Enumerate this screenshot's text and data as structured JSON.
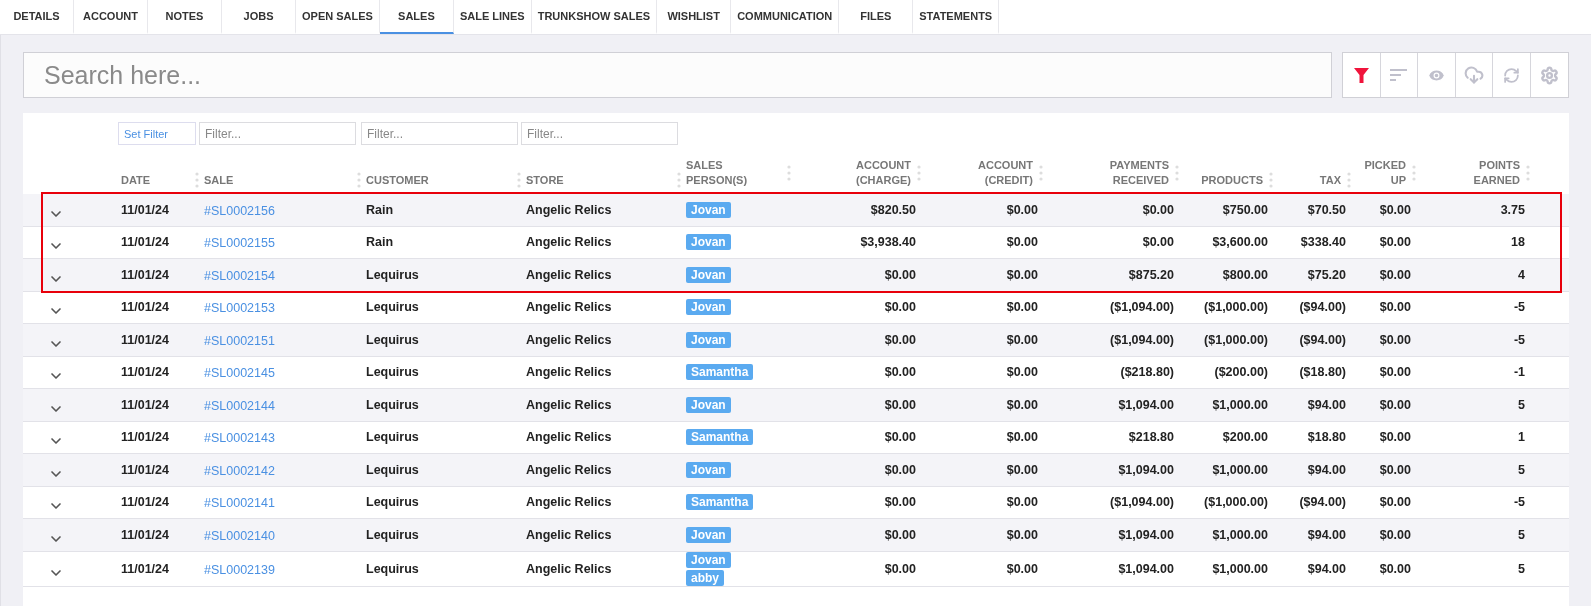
{
  "tabs": [
    {
      "label": "DETAILS",
      "selected": false
    },
    {
      "label": "ACCOUNT",
      "selected": false
    },
    {
      "label": "NOTES",
      "selected": false
    },
    {
      "label": "JOBS",
      "selected": false
    },
    {
      "label": "OPEN SALES",
      "selected": false
    },
    {
      "label": "SALES",
      "selected": true
    },
    {
      "label": "SALE LINES",
      "selected": false
    },
    {
      "label": "TRUNKSHOW SALES",
      "selected": false
    },
    {
      "label": "WISHLIST",
      "selected": false
    },
    {
      "label": "COMMUNICATION",
      "selected": false
    },
    {
      "label": "FILES",
      "selected": false
    },
    {
      "label": "STATEMENTS",
      "selected": false
    }
  ],
  "search": {
    "placeholder": "Search here..."
  },
  "toolbar": [
    {
      "kind": "filter",
      "active": true
    },
    {
      "kind": "sort",
      "active": false
    },
    {
      "kind": "view",
      "active": false
    },
    {
      "kind": "download",
      "active": false
    },
    {
      "kind": "refresh",
      "active": false
    },
    {
      "kind": "settings",
      "active": false
    }
  ],
  "filters": {
    "set_filter": "Set Filter",
    "fields": [
      {
        "placeholder": "Filter..."
      },
      {
        "placeholder": "Filter..."
      },
      {
        "placeholder": "Filter..."
      }
    ]
  },
  "table": {
    "columns": [
      "DATE",
      "SALE",
      "CUSTOMER",
      "STORE",
      "SALES PERSON(S)",
      "ACCOUNT (CHARGE)",
      "ACCOUNT (CREDIT)",
      "PAYMENTS RECEIVED",
      "PRODUCTS",
      "TAX",
      "PICKED UP",
      "POINTS EARNED"
    ],
    "highlighted_rows": [
      {
        "date": "11/01/24",
        "sale": "#SL0002156",
        "customer": "Rain",
        "store": "Angelic Relics",
        "sales_persons": [
          "Jovan"
        ],
        "values": [
          "$820.50",
          "$0.00",
          "$0.00",
          "$750.00",
          "$70.50",
          "$0.00",
          "3.75"
        ]
      },
      {
        "date": "11/01/24",
        "sale": "#SL0002155",
        "customer": "Rain",
        "store": "Angelic Relics",
        "sales_persons": [
          "Jovan"
        ],
        "values": [
          "$3,938.40",
          "$0.00",
          "$0.00",
          "$3,600.00",
          "$338.40",
          "$0.00",
          "18"
        ]
      },
      {
        "date": "11/01/24",
        "sale": "#SL0002154",
        "customer": "Lequirus",
        "store": "Angelic Relics",
        "sales_persons": [
          "Jovan"
        ],
        "values": [
          "$0.00",
          "$0.00",
          "$875.20",
          "$800.00",
          "$75.20",
          "$0.00",
          "4"
        ]
      }
    ],
    "rows": [
      {
        "date": "11/01/24",
        "sale": "#SL0002153",
        "customer": "Lequirus",
        "store": "Angelic Relics",
        "sales_persons": [
          "Jovan"
        ],
        "values": [
          "$0.00",
          "$0.00",
          "($1,094.00)",
          "($1,000.00)",
          "($94.00)",
          "$0.00",
          "-5"
        ]
      },
      {
        "date": "11/01/24",
        "sale": "#SL0002151",
        "customer": "Lequirus",
        "store": "Angelic Relics",
        "sales_persons": [
          "Jovan"
        ],
        "values": [
          "$0.00",
          "$0.00",
          "($1,094.00)",
          "($1,000.00)",
          "($94.00)",
          "$0.00",
          "-5"
        ]
      },
      {
        "date": "11/01/24",
        "sale": "#SL0002145",
        "customer": "Lequirus",
        "store": "Angelic Relics",
        "sales_persons": [
          "Samantha"
        ],
        "values": [
          "$0.00",
          "$0.00",
          "($218.80)",
          "($200.00)",
          "($18.80)",
          "$0.00",
          "-1"
        ]
      },
      {
        "date": "11/01/24",
        "sale": "#SL0002144",
        "customer": "Lequirus",
        "store": "Angelic Relics",
        "sales_persons": [
          "Jovan"
        ],
        "values": [
          "$0.00",
          "$0.00",
          "$1,094.00",
          "$1,000.00",
          "$94.00",
          "$0.00",
          "5"
        ]
      },
      {
        "date": "11/01/24",
        "sale": "#SL0002143",
        "customer": "Lequirus",
        "store": "Angelic Relics",
        "sales_persons": [
          "Samantha"
        ],
        "values": [
          "$0.00",
          "$0.00",
          "$218.80",
          "$200.00",
          "$18.80",
          "$0.00",
          "1"
        ]
      },
      {
        "date": "11/01/24",
        "sale": "#SL0002142",
        "customer": "Lequirus",
        "store": "Angelic Relics",
        "sales_persons": [
          "Jovan"
        ],
        "values": [
          "$0.00",
          "$0.00",
          "$1,094.00",
          "$1,000.00",
          "$94.00",
          "$0.00",
          "5"
        ]
      },
      {
        "date": "11/01/24",
        "sale": "#SL0002141",
        "customer": "Lequirus",
        "store": "Angelic Relics",
        "sales_persons": [
          "Samantha"
        ],
        "values": [
          "$0.00",
          "$0.00",
          "($1,094.00)",
          "($1,000.00)",
          "($94.00)",
          "$0.00",
          "-5"
        ]
      },
      {
        "date": "11/01/24",
        "sale": "#SL0002140",
        "customer": "Lequirus",
        "store": "Angelic Relics",
        "sales_persons": [
          "Jovan"
        ],
        "values": [
          "$0.00",
          "$0.00",
          "$1,094.00",
          "$1,000.00",
          "$94.00",
          "$0.00",
          "5"
        ]
      },
      {
        "date": "11/01/24",
        "sale": "#SL0002139",
        "customer": "Lequirus",
        "store": "Angelic Relics",
        "sales_persons": [
          "Jovan",
          "abby"
        ],
        "values": [
          "$0.00",
          "$0.00",
          "$1,094.00",
          "$1,000.00",
          "$94.00",
          "$0.00",
          "5"
        ]
      }
    ]
  }
}
